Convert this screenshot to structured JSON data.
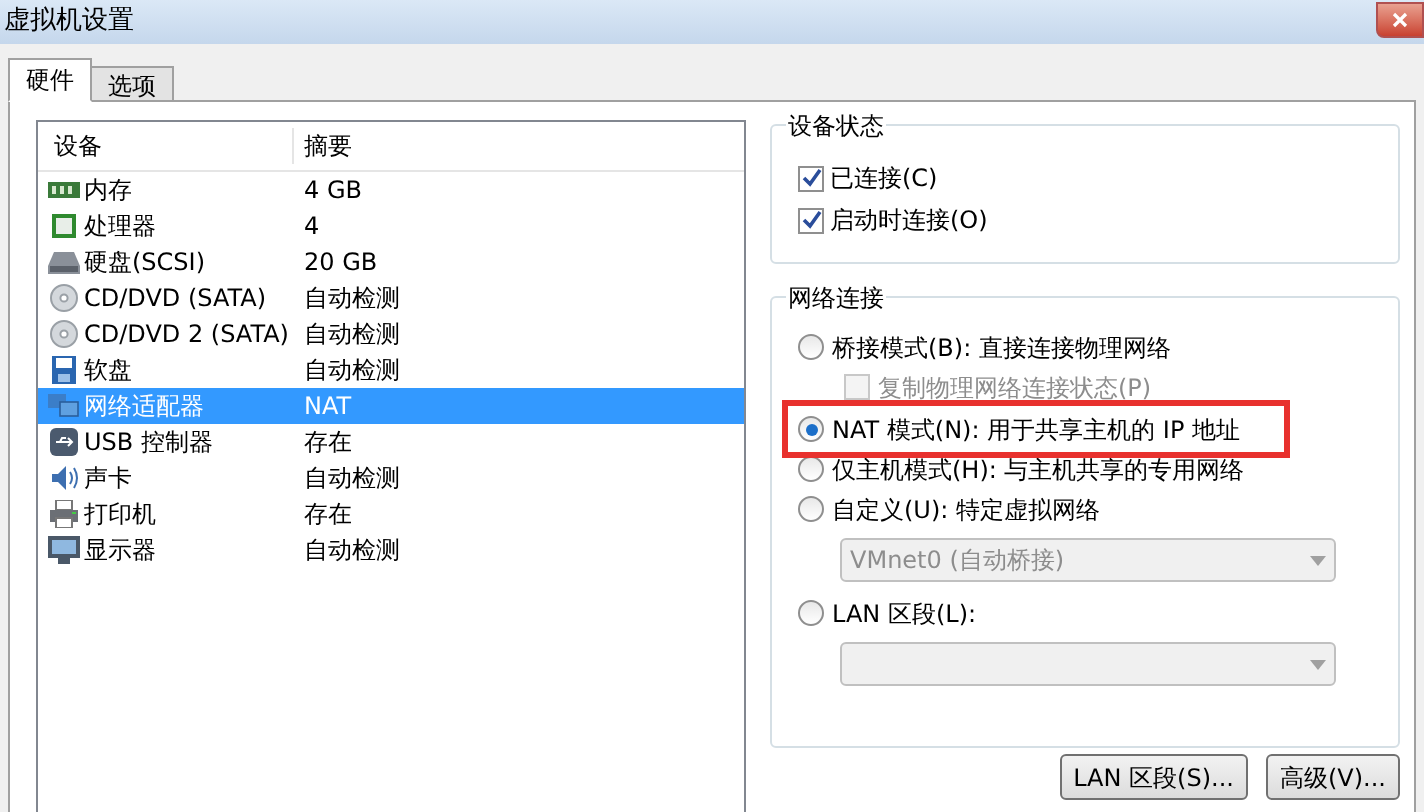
{
  "window": {
    "title": "虚拟机设置"
  },
  "tabs": [
    {
      "label": "硬件",
      "selected": true
    },
    {
      "label": "选项",
      "selected": false
    }
  ],
  "device_list": {
    "columns": [
      "设备",
      "摘要"
    ],
    "rows": [
      {
        "kind": "memory",
        "device": "内存",
        "summary": "4 GB",
        "selected": false
      },
      {
        "kind": "cpu",
        "device": "处理器",
        "summary": "4",
        "selected": false
      },
      {
        "kind": "disk",
        "device": "硬盘(SCSI)",
        "summary": "20 GB",
        "selected": false
      },
      {
        "kind": "cdrom",
        "device": "CD/DVD (SATA)",
        "summary": "自动检测",
        "selected": false
      },
      {
        "kind": "cdrom",
        "device": "CD/DVD 2 (SATA)",
        "summary": "自动检测",
        "selected": false
      },
      {
        "kind": "floppy",
        "device": "软盘",
        "summary": "自动检测",
        "selected": false
      },
      {
        "kind": "network",
        "device": "网络适配器",
        "summary": "NAT",
        "selected": true
      },
      {
        "kind": "usb",
        "device": "USB 控制器",
        "summary": "存在",
        "selected": false
      },
      {
        "kind": "sound",
        "device": "声卡",
        "summary": "自动检测",
        "selected": false
      },
      {
        "kind": "printer",
        "device": "打印机",
        "summary": "存在",
        "selected": false
      },
      {
        "kind": "display",
        "device": "显示器",
        "summary": "自动检测",
        "selected": false
      }
    ]
  },
  "device_status": {
    "title": "设备状态",
    "options": [
      {
        "label": "已连接(C)",
        "checked": true
      },
      {
        "label": "启动时连接(O)",
        "checked": true
      }
    ]
  },
  "network_connection": {
    "title": "网络连接",
    "items": [
      {
        "kind": "radio",
        "label": "桥接模式(B): 直接连接物理网络",
        "selected": false,
        "highlighted": false
      },
      {
        "kind": "checkbox",
        "label": "复制物理网络连接状态(P)",
        "checked": false,
        "disabled": true
      },
      {
        "kind": "radio",
        "label": "NAT 模式(N): 用于共享主机的 IP 地址",
        "selected": true,
        "highlighted": true
      },
      {
        "kind": "radio",
        "label": "仅主机模式(H): 与主机共享的专用网络",
        "selected": false,
        "highlighted": false
      },
      {
        "kind": "radio",
        "label": "自定义(U): 特定虚拟网络",
        "selected": false,
        "highlighted": false
      },
      {
        "kind": "dropdown",
        "value": "VMnet0 (自动桥接)",
        "disabled": true
      },
      {
        "kind": "radio",
        "label": "LAN 区段(L):",
        "selected": false,
        "highlighted": false
      },
      {
        "kind": "dropdown",
        "disabled": true
      }
    ]
  },
  "buttons": [
    "LAN 区段(S)...",
    "高级(V)..."
  ]
}
